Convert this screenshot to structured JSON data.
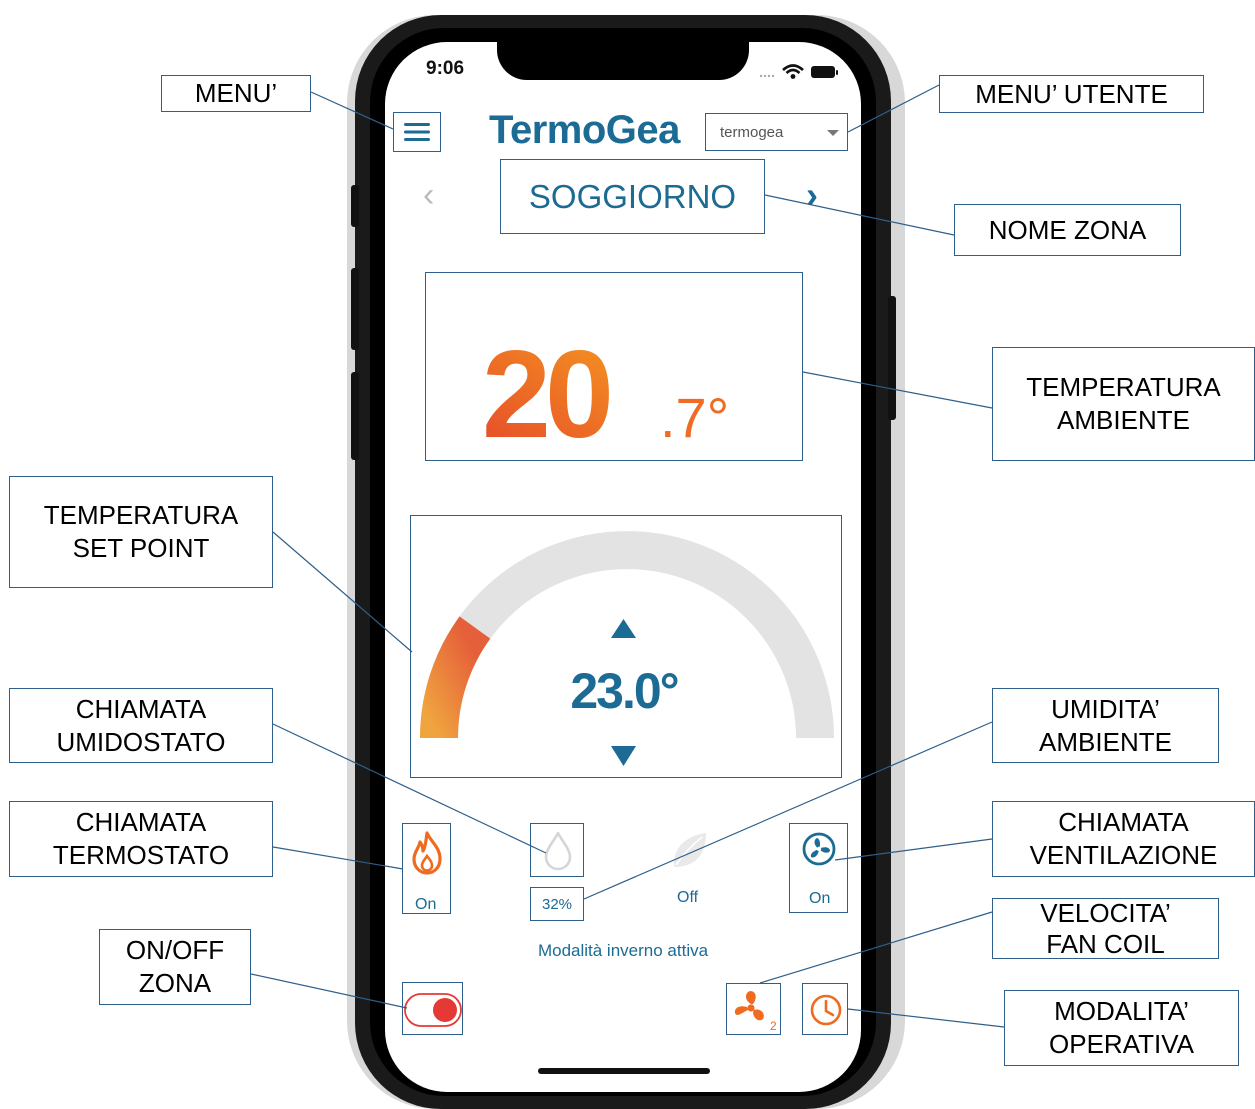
{
  "status_bar": {
    "time": "9:06"
  },
  "app": {
    "brand_part1": "Termo",
    "brand_part2": "Gea",
    "user_select_value": "termogea",
    "zone_name": "SOGGIORNO",
    "nav_prev": "‹",
    "nav_next": "›",
    "room_temp_int": "20",
    "room_temp_dec": ".7°",
    "setpoint": "23.0°",
    "humidity_value": "32%",
    "eco_status": "Off",
    "thermostat_status": "On",
    "ventilation_status": "On",
    "mode_text": "Modalità inverno attiva",
    "fan_speed": "2",
    "setpoint_arc_fraction": 0.2,
    "colors": {
      "brand_blue": "#1b6b94",
      "accent_orange": "#e8612a",
      "off_gray": "#e3e3e3",
      "toggle_red": "#e53935"
    }
  },
  "callouts": {
    "menu": "MENU’",
    "user_menu": "MENU’ UTENTE",
    "zone_name": "NOME ZONA",
    "room_temp_l1": "TEMPERATURA",
    "room_temp_l2": "AMBIENTE",
    "setpoint_l1": "TEMPERATURA",
    "setpoint_l2": "SET POINT",
    "humidistat_l1": "CHIAMATA",
    "humidistat_l2": "UMIDOSTATO",
    "humidity_l1": "UMIDITA’",
    "humidity_l2": "AMBIENTE",
    "thermostat_l1": "CHIAMATA",
    "thermostat_l2": "TERMOSTATO",
    "ventilation_l1": "CHIAMATA",
    "ventilation_l2": "VENTILAZIONE",
    "fan_speed_l1": "VELOCITA’",
    "fan_speed_l2": "FAN COIL",
    "onoff_l1": "ON/OFF",
    "onoff_l2": "ZONA",
    "mode_l1": "MODALITA’",
    "mode_l2": "OPERATIVA"
  }
}
